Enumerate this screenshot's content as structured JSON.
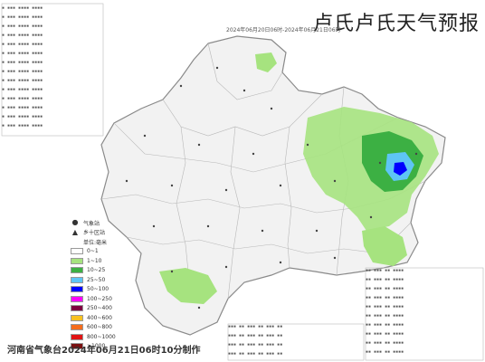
{
  "page": {
    "title": "卢氏卢氏天气预报",
    "credit": "河南省气象台2024年06月21日06时10分制作",
    "map_header": "2024年06月20日06时-2024年06月21日06时"
  },
  "legend": {
    "items": [
      {
        "label": "气象站",
        "symbol": "●"
      },
      {
        "label": "乡十区站",
        "symbol": "▲"
      },
      {
        "label": "单位:毫米",
        "symbol": ""
      },
      {
        "label": "0~1",
        "color": "#ffffff"
      },
      {
        "label": "1~10",
        "color": "#a6e37f"
      },
      {
        "label": "10~25",
        "color": "#3cb043"
      },
      {
        "label": "25~50",
        "color": "#5ec5f5"
      },
      {
        "label": "50~100",
        "color": "#0000fe"
      },
      {
        "label": "100~250",
        "color": "#fa00fa"
      },
      {
        "label": "250~400",
        "color": "#800040"
      },
      {
        "label": "400~600",
        "color": "#f7c120"
      },
      {
        "label": "600~800",
        "color": "#f56d1c"
      },
      {
        "label": "800~1000",
        "color": "#e01414"
      },
      {
        "label": "≥1000",
        "color": "#7a1111"
      }
    ]
  },
  "colors": {
    "province_fill": "#f2f2f2",
    "border": "#9a9a9a",
    "rain_light": "#a6e37f",
    "rain_moderate": "#3cb043",
    "rain_heavy": "#5ec5f5",
    "rain_storm": "#0000fe"
  }
}
